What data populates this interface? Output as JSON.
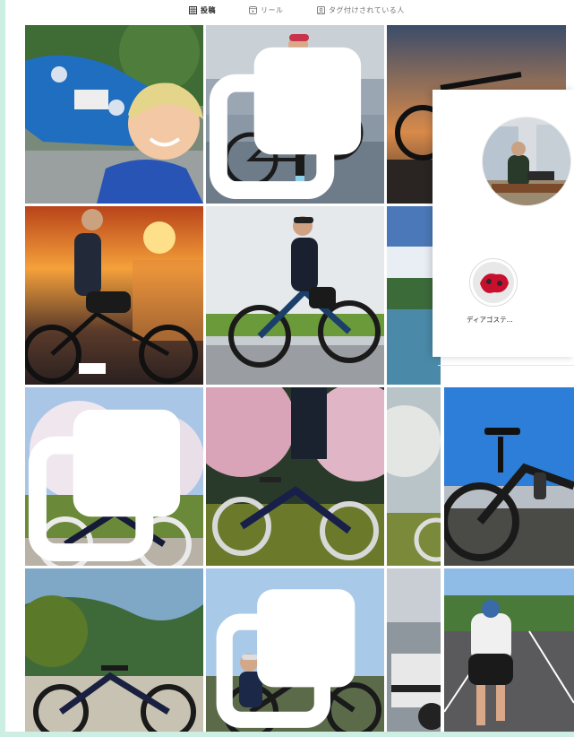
{
  "tabs": [
    {
      "label": "投稿",
      "active": true,
      "icon": "grid-icon"
    },
    {
      "label": "リール",
      "active": false,
      "icon": "reels-icon"
    },
    {
      "label": "タグ付けされている人",
      "active": false,
      "icon": "tagged-icon"
    }
  ],
  "highlight": {
    "label": "ディアゴステ..."
  },
  "colors": {
    "tab_active": "#262626",
    "tab_inactive": "#737373",
    "edge": "#cdeee3"
  }
}
